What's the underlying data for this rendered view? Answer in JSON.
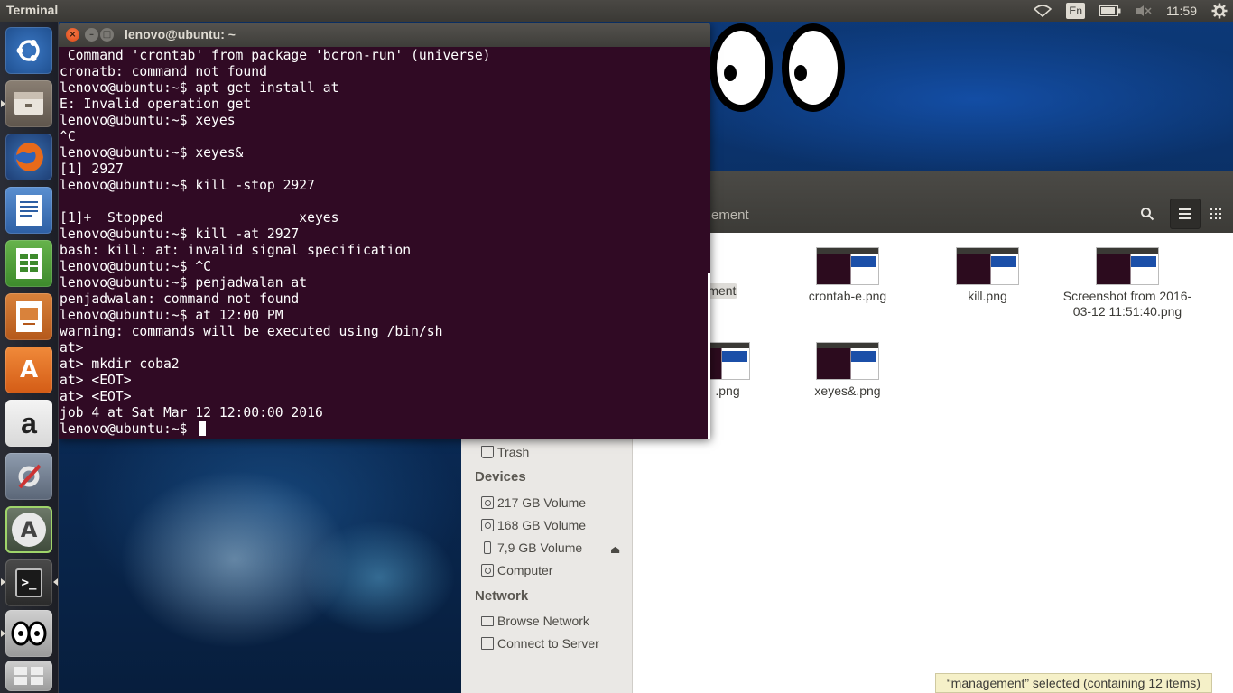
{
  "top_panel": {
    "app_title": "Terminal",
    "lang": "En",
    "clock": "11:59",
    "icons": [
      "wifi-icon",
      "battery-icon",
      "volume-muted-icon",
      "gear-icon"
    ]
  },
  "launcher": {
    "items": [
      {
        "name": "ubuntu-dash-icon",
        "glyph": ""
      },
      {
        "name": "files-icon",
        "glyph": ""
      },
      {
        "name": "firefox-icon",
        "glyph": ""
      },
      {
        "name": "libreoffice-writer-icon",
        "glyph": ""
      },
      {
        "name": "libreoffice-calc-icon",
        "glyph": ""
      },
      {
        "name": "libreoffice-impress-icon",
        "glyph": ""
      },
      {
        "name": "software-center-icon",
        "glyph": "A"
      },
      {
        "name": "amazon-icon",
        "glyph": "a"
      },
      {
        "name": "system-settings-icon",
        "glyph": ""
      },
      {
        "name": "software-updater-icon",
        "glyph": "A"
      },
      {
        "name": "terminal-icon",
        "glyph": ">_"
      },
      {
        "name": "xeyes-icon",
        "glyph": ""
      },
      {
        "name": "workspace-switcher-icon",
        "glyph": ""
      }
    ]
  },
  "terminal": {
    "title": "lenovo@ubuntu: ~",
    "lines": [
      " Command 'crontab' from package 'bcron-run' (universe)",
      "cronatb: command not found",
      "lenovo@ubuntu:~$ apt get install at",
      "E: Invalid operation get",
      "lenovo@ubuntu:~$ xeyes",
      "^C",
      "lenovo@ubuntu:~$ xeyes&",
      "[1] 2927",
      "lenovo@ubuntu:~$ kill -stop 2927",
      "",
      "[1]+  Stopped                 xeyes",
      "lenovo@ubuntu:~$ kill -at 2927",
      "bash: kill: at: invalid signal specification",
      "lenovo@ubuntu:~$ ^C",
      "lenovo@ubuntu:~$ penjadwalan at",
      "penjadwalan: command not found",
      "lenovo@ubuntu:~$ at 12:00 PM",
      "warning: commands will be executed using /bin/sh",
      "at>",
      "at> mkdir coba2",
      "at> <EOT>",
      "at> <EOT>",
      "job 4 at Sat Mar 12 12:00:00 2016",
      "lenovo@ubuntu:~$ "
    ],
    "colors": {
      "background": "#300a24",
      "text": "#ffffff"
    }
  },
  "files": {
    "breadcrumb": "ement",
    "sidebar": {
      "trash": "Trash",
      "devices_heading": "Devices",
      "devices": [
        "217 GB Volume",
        "168 GB Volume",
        "7,9 GB Volume",
        "Computer"
      ],
      "network_heading": "Network",
      "network": [
        "Browse Network",
        "Connect to Server"
      ]
    },
    "items": [
      {
        "label": "ement",
        "kind": "folder"
      },
      {
        "label": "crontab-e.png",
        "kind": "image"
      },
      {
        "label": "kill.png",
        "kind": "image"
      },
      {
        "label": "Screenshot from 2016-03-12 11:51:40.png",
        "kind": "image"
      },
      {
        "label": ".png",
        "kind": "image"
      },
      {
        "label": "xeyes&.png",
        "kind": "image"
      }
    ],
    "status": "“management” selected  (containing 12 items)"
  }
}
